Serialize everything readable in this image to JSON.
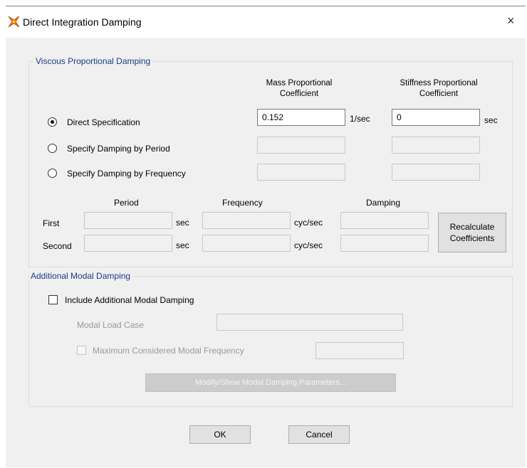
{
  "window": {
    "title": "Direct Integration Damping",
    "app_icon": "sap-icon",
    "close_glyph": "×"
  },
  "viscous": {
    "group_label": "Viscous Proportional Damping",
    "mass_header": [
      "Mass Proportional",
      "Coefficient"
    ],
    "stiff_header": [
      "Stiffness Proportional",
      "Coefficient"
    ],
    "options": [
      {
        "label": "Direct Specification",
        "selected": true
      },
      {
        "label": "Specify Damping by Period",
        "selected": false
      },
      {
        "label": "Specify Damping by Frequency",
        "selected": false
      }
    ],
    "mass_value": "0.152",
    "mass_unit": "1/sec",
    "stiff_value": "0",
    "stiff_unit": "sec",
    "columns": {
      "period": "Period",
      "frequency": "Frequency",
      "damping": "Damping"
    },
    "rows": [
      {
        "label": "First",
        "period_unit": "sec",
        "freq_unit": "cyc/sec"
      },
      {
        "label": "Second",
        "period_unit": "sec",
        "freq_unit": "cyc/sec"
      }
    ],
    "recalc_label": [
      "Recalculate",
      "Coefficients"
    ]
  },
  "modal": {
    "group_label": "Additional Modal Damping",
    "include_label": "Include Additional Modal Damping",
    "include_checked": false,
    "load_case_label": "Modal Load Case",
    "max_freq_label": "Maximum Considered Modal Frequency",
    "modify_button": "Modify/Show Modal Damping Parameters..."
  },
  "footer": {
    "ok": "OK",
    "cancel": "Cancel"
  }
}
